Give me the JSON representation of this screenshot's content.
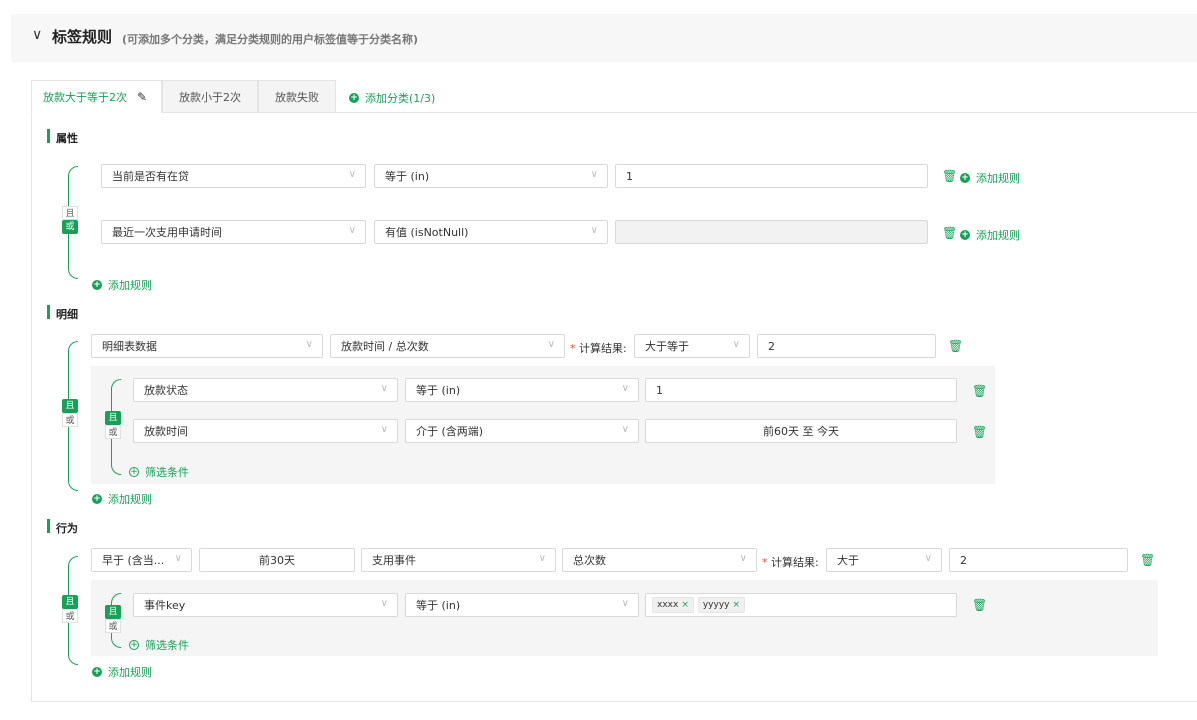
{
  "header": {
    "chevron": "∨",
    "title": "标签规则",
    "hint": "(可添加多个分类，满足分类规则的用户标签值等于分类名称)"
  },
  "tabs": [
    {
      "label": "放款大于等于2次",
      "edit_icon": "✎"
    },
    {
      "label": "放款小于2次"
    },
    {
      "label": "放款失败"
    }
  ],
  "add_category": "添加分类(1/3)",
  "plus": "+",
  "andor": {
    "and": "且",
    "or": "或"
  },
  "trash": "🗑",
  "chev": "∨",
  "attributes": {
    "title": "属性",
    "rows": [
      {
        "field": "当前是否有在贷",
        "op": "等于 (in)",
        "value": "1",
        "add_rule": "添加规则"
      },
      {
        "field": "最近一次支用申请时间",
        "op": "有值 (isNotNull)",
        "value": "",
        "add_rule": "添加规则"
      }
    ],
    "add_rule": "添加规则"
  },
  "detail": {
    "title": "明细",
    "source": "明细表数据",
    "metric": "放款时间 / 总次数",
    "calc_label": "计算结果:",
    "calc_op": "大于等于",
    "calc_value": "2",
    "filters": [
      {
        "field": "放款状态",
        "op": "等于 (in)",
        "value": "1"
      },
      {
        "field": "放款时间",
        "op": "介于 (含两端)",
        "value": "前60天 至 今天"
      }
    ],
    "filter_link": "筛选条件",
    "add_rule": "添加规则"
  },
  "behavior": {
    "title": "行为",
    "time_op": "早于 (含当...",
    "time_value": "前30天",
    "event": "支用事件",
    "metric": "总次数",
    "calc_label": "计算结果:",
    "calc_op": "大于",
    "calc_value": "2",
    "filter": {
      "field": "事件key",
      "op": "等于 (in)",
      "tags": [
        "xxxx",
        "yyyyy"
      ]
    },
    "tag_close": "×",
    "filter_link": "筛选条件",
    "add_rule": "添加规则"
  },
  "colors": {
    "accent": "#18a058"
  }
}
